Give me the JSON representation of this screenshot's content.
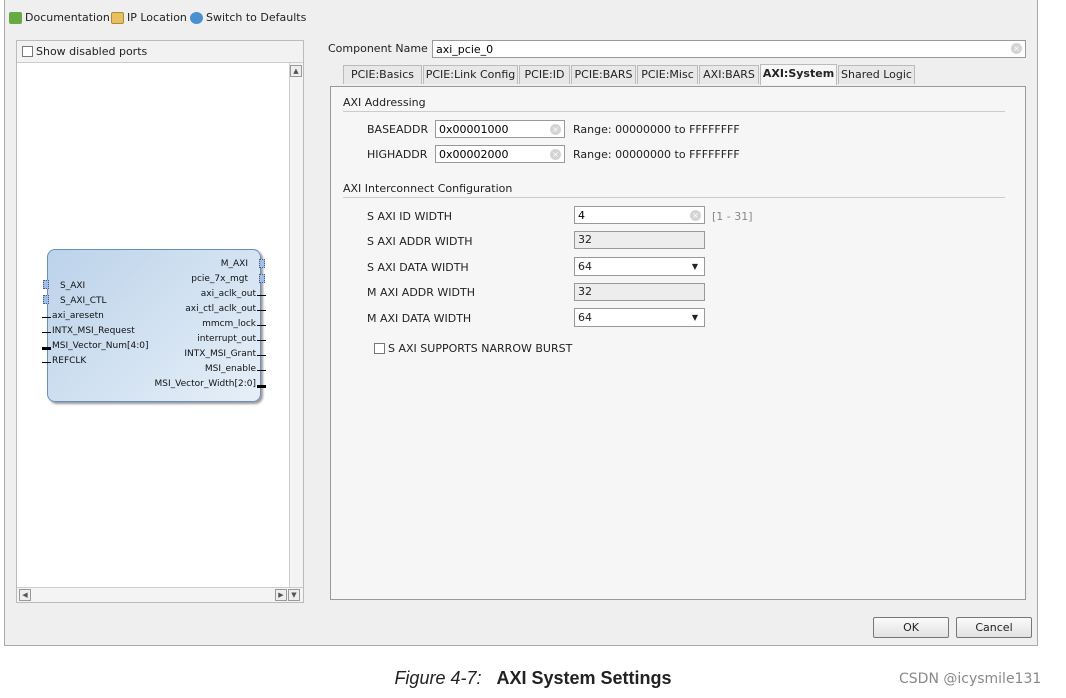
{
  "toolbar": {
    "documentation": "Documentation",
    "ip_location": "IP Location",
    "switch_defaults": "Switch to Defaults"
  },
  "left_panel": {
    "show_disabled_ports": "Show disabled ports",
    "block": {
      "left_ports": [
        "S_AXI",
        "S_AXI_CTL",
        "axi_aresetn",
        "INTX_MSI_Request",
        "MSI_Vector_Num[4:0]",
        "REFCLK"
      ],
      "right_ports": [
        "M_AXI",
        "pcie_7x_mgt",
        "axi_aclk_out",
        "axi_ctl_aclk_out",
        "mmcm_lock",
        "interrupt_out",
        "INTX_MSI_Grant",
        "MSI_enable",
        "MSI_Vector_Width[2:0]"
      ]
    }
  },
  "component_name": {
    "label": "Component Name",
    "value": "axi_pcie_0"
  },
  "tabs": [
    {
      "label": "PCIE:Basics"
    },
    {
      "label": "PCIE:Link Config"
    },
    {
      "label": "PCIE:ID"
    },
    {
      "label": "PCIE:BARS"
    },
    {
      "label": "PCIE:Misc"
    },
    {
      "label": "AXI:BARS"
    },
    {
      "label": "AXI:System",
      "active": true
    },
    {
      "label": "Shared Logic"
    }
  ],
  "axi_addressing": {
    "title": "AXI Addressing",
    "baseaddr": {
      "label": "BASEADDR",
      "value": "0x00001000",
      "range": "Range: 00000000 to FFFFFFFF"
    },
    "highaddr": {
      "label": "HIGHADDR",
      "value": "0x00002000",
      "range": "Range: 00000000 to FFFFFFFF"
    }
  },
  "interconnect": {
    "title": "AXI Interconnect Configuration",
    "s_id_width": {
      "label": "S AXI ID WIDTH",
      "value": "4",
      "range": "[1 - 31]"
    },
    "s_addr_width": {
      "label": "S AXI ADDR WIDTH",
      "value": "32"
    },
    "s_data_width": {
      "label": "S AXI DATA WIDTH",
      "value": "64"
    },
    "m_addr_width": {
      "label": "M AXI ADDR WIDTH",
      "value": "32"
    },
    "m_data_width": {
      "label": "M AXI DATA WIDTH",
      "value": "64"
    },
    "narrow_burst": {
      "label": "S AXI SUPPORTS NARROW BURST",
      "checked": false
    }
  },
  "buttons": {
    "ok": "OK",
    "cancel": "Cancel"
  },
  "caption": {
    "number": "Figure 4-7:",
    "title": "AXI System Settings"
  },
  "watermark": "CSDN @icysmile131"
}
